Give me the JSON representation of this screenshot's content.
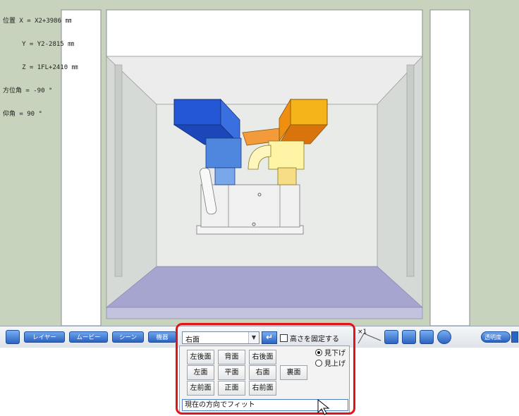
{
  "coords": {
    "line1": "位置 X = X2+3986 ㎜",
    "line2": "     Y = Y2-2815 ㎜",
    "line3": "     Z = 1FL+2410 ㎜",
    "line4": "方位角 = -90 °",
    "line5": "仰角 = 90 °"
  },
  "toolbar": {
    "layer_label": "レイヤー",
    "movie_label": "ムービー",
    "scene_label": "シーン",
    "equipment_label": "機器",
    "opacity_label": "透明度",
    "zoom_label": "×1"
  },
  "view_panel": {
    "selected_view": "右面",
    "fix_height_label": "高さを固定する",
    "row1": [
      "左後面",
      "背面",
      "右後面"
    ],
    "row2": [
      "左面",
      "平面",
      "右面",
      "裏面"
    ],
    "row3": [
      "左前面",
      "正面",
      "右前面"
    ],
    "look_down_label": "見下げ",
    "look_up_label": "見上げ",
    "fit_label": "現在の方向でフィット"
  },
  "colors": {
    "viewport_bg": "#c7d3bd",
    "highlight": "#e0151b",
    "accent": "#2b63c0"
  }
}
